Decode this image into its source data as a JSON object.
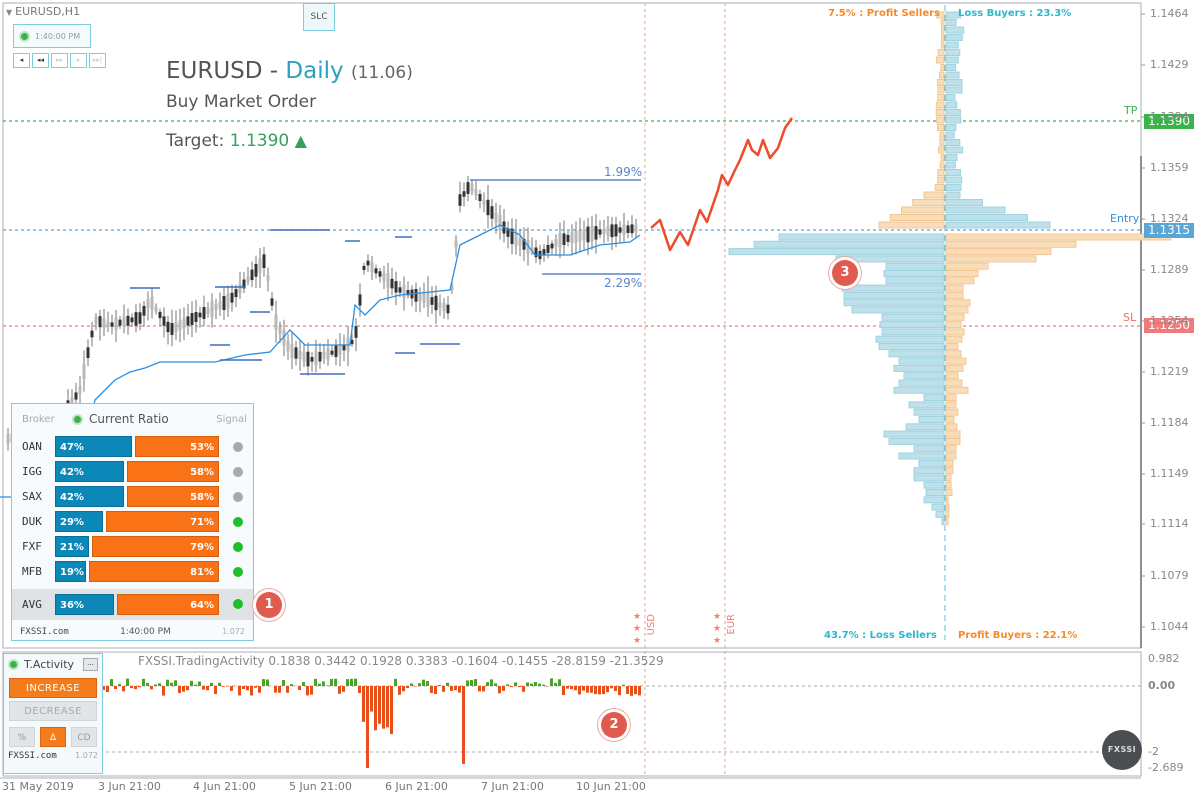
{
  "header": {
    "symbol_timeframe": "EURUSD,H1",
    "slc_label": "SLC",
    "clock_time": "1:40:00 PM",
    "nav_buttons": [
      "◂",
      "◂◂",
      "▸▸",
      "▸",
      "▸▸|"
    ]
  },
  "title": {
    "symbol": "EURUSD",
    "separator": " - ",
    "timeframe": "Daily",
    "version": "(11.06)",
    "order_type": "Buy Market Order",
    "target_label": "Target:",
    "target_value": "1.1390",
    "target_arrow": "🡅"
  },
  "levels": {
    "tp": {
      "label": "TP",
      "value": "1.1390",
      "color": "#3cb34a"
    },
    "entry": {
      "label": "Entry",
      "value": "1.1315",
      "color": "#5aa7d6"
    },
    "sl": {
      "label": "SL",
      "value": "1.1250",
      "color": "#f07b7b"
    }
  },
  "price_axis": {
    "ticks": [
      "1.1464",
      "1.1429",
      "1.1394",
      "1.1359",
      "1.1324",
      "1.1289",
      "1.1254",
      "1.1219",
      "1.1184",
      "1.1149",
      "1.1114",
      "1.1079",
      "1.1044"
    ],
    "range": [
      1.103,
      1.1475
    ]
  },
  "range_labels": {
    "upper": "1.99%",
    "lower": "2.29%"
  },
  "sentiment": {
    "top_left": "7.5% : Profit Sellers",
    "top_right": "Loss Buyers : 23.3%",
    "bottom_left": "43.7% : Loss Sellers",
    "bottom_right": "Profit Buyers : 22.1%"
  },
  "news_markers": [
    {
      "currency": "USD",
      "stars": "★★★"
    },
    {
      "currency": "EUR",
      "stars": "★★★"
    }
  ],
  "ratio_panel": {
    "header_broker": "Broker",
    "header_title": "Current Ratio",
    "header_signal": "Signal",
    "rows": [
      {
        "broker": "OAN",
        "long": 47,
        "short": 53,
        "long_label": "47%",
        "short_label": "53%",
        "signal": "neutral"
      },
      {
        "broker": "IGG",
        "long": 42,
        "short": 58,
        "long_label": "42%",
        "short_label": "58%",
        "signal": "neutral"
      },
      {
        "broker": "SAX",
        "long": 42,
        "short": 58,
        "long_label": "42%",
        "short_label": "58%",
        "signal": "neutral"
      },
      {
        "broker": "DUK",
        "long": 29,
        "short": 71,
        "long_label": "29%",
        "short_label": "71%",
        "signal": "buy"
      },
      {
        "broker": "FXF",
        "long": 21,
        "short": 79,
        "long_label": "21%",
        "short_label": "79%",
        "signal": "buy"
      },
      {
        "broker": "MFB",
        "long": 19,
        "short": 81,
        "long_label": "19%",
        "short_label": "81%",
        "signal": "buy"
      }
    ],
    "avg": {
      "broker": "AVG",
      "long": 36,
      "short": 64,
      "long_label": "36%",
      "short_label": "64%",
      "signal": "buy"
    },
    "footer_brand": "FXSSI.com",
    "footer_time": "1:40:00 PM",
    "footer_version": "1.072",
    "signal_colors": {
      "neutral": "#a9a9a9",
      "buy": "#1fbf2a"
    }
  },
  "badges": [
    "1",
    "2",
    "3"
  ],
  "activity_panel": {
    "title": "T.Activity",
    "minimize": "...",
    "increase_label": "INCREASE",
    "decrease_label": "DECREASE",
    "mode_buttons": [
      {
        "label": "%",
        "active": false
      },
      {
        "label": "Δ",
        "active": true
      },
      {
        "label": "CD",
        "active": false
      }
    ],
    "footer_brand": "FXSSI.com",
    "footer_version": "1.072"
  },
  "indicator": {
    "label": "FXSSI.TradingActivity 0.1838 0.3442 0.1928 0.3383 -0.1604 -0.1455 -28.8159 -21.3529",
    "axis_ticks": [
      "0.982",
      "0.00",
      "-2",
      "-2.689"
    ]
  },
  "time_axis": [
    "31 May 2019",
    "3 Jun 21:00",
    "4 Jun 21:00",
    "5 Jun 21:00",
    "6 Jun 21:00",
    "7 Jun 21:00",
    "10 Jun 21:00"
  ],
  "logo": "FXSSI",
  "colors": {
    "bull": "#4aa329",
    "bear": "#e8501a",
    "forecast": "#ef4a2a",
    "profile_blue": "#bde0ea",
    "profile_orange": "#f9dcb8"
  }
}
